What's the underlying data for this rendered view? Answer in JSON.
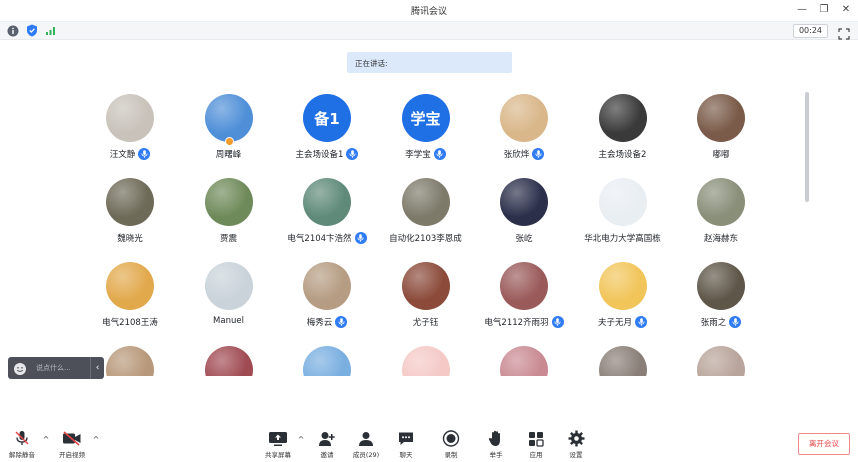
{
  "window": {
    "title": "腾讯会议"
  },
  "statusbar": {
    "timer": "00:24"
  },
  "speaking": {
    "label": "正在讲话:"
  },
  "participants": [
    {
      "name": "汪文静",
      "bg": "#c8c2ba",
      "mic": true
    },
    {
      "name": "周曙峰",
      "bg": "#4f8fd8",
      "mic": false,
      "host": true
    },
    {
      "name": "主会场设备1",
      "avatar_text": "备1",
      "mic": true
    },
    {
      "name": "李学宝",
      "avatar_text": "学宝",
      "mic": true
    },
    {
      "name": "张欣烨",
      "bg": "#d9b78a",
      "mic": true
    },
    {
      "name": "主会场设备2",
      "bg": "#3a3a3a",
      "mic": false
    },
    {
      "name": "嘟嘟",
      "bg": "#7a5a48",
      "mic": false
    },
    {
      "name": "魏晓光",
      "bg": "#6e6a58",
      "mic": false
    },
    {
      "name": "贾震",
      "bg": "#6f8a5a",
      "mic": false
    },
    {
      "name": "电气2104卞浩然",
      "bg": "#5f8a7a",
      "mic": true
    },
    {
      "name": "自动化2103李恩成",
      "bg": "#7d7a6a",
      "mic": false
    },
    {
      "name": "张屹",
      "bg": "#2b2f4a",
      "mic": false
    },
    {
      "name": "华北电力大学高国栋",
      "bg": "#e9eef3",
      "mic": false
    },
    {
      "name": "赵海赫东",
      "bg": "#8a8f7a",
      "mic": false
    },
    {
      "name": "电气2108王涛",
      "bg": "#e2a94c",
      "mic": false
    },
    {
      "name": "Manuel",
      "bg": "#c9d3d9",
      "mic": false
    },
    {
      "name": "梅秀云",
      "bg": "#b59c82",
      "mic": true
    },
    {
      "name": "尤子钰",
      "bg": "#8b4a3a",
      "mic": false
    },
    {
      "name": "电气2112齐雨羽",
      "bg": "#9a5a5a",
      "mic": true
    },
    {
      "name": "夫子无月",
      "bg": "#f1c55a",
      "mic": true
    },
    {
      "name": "张雨之",
      "bg": "#5e5648",
      "mic": true
    },
    {
      "name": "",
      "bg": "#b8987a",
      "mic": false
    },
    {
      "name": "",
      "bg": "#a04a52",
      "mic": false
    },
    {
      "name": "",
      "bg": "#79aee0",
      "mic": false
    },
    {
      "name": "",
      "bg": "#f4c9c6",
      "mic": false
    },
    {
      "name": "",
      "bg": "#c98a92",
      "mic": false
    },
    {
      "name": "",
      "bg": "#8a7f78",
      "mic": false
    },
    {
      "name": "",
      "bg": "#b8a49a",
      "mic": false
    }
  ],
  "chat": {
    "placeholder": "说点什么..."
  },
  "toolbar": {
    "mute": "解除静音",
    "video": "开启视频",
    "share": "共享屏幕",
    "invite": "邀请",
    "members": "成员(29)",
    "chat": "聊天",
    "record": "录制",
    "raise_hand": "举手",
    "apps": "应用",
    "settings": "设置",
    "leave": "离开会议"
  },
  "colors": {
    "accent": "#2f7cf6",
    "leave": "#e54545",
    "speaking_bg": "#dbe9fb"
  }
}
